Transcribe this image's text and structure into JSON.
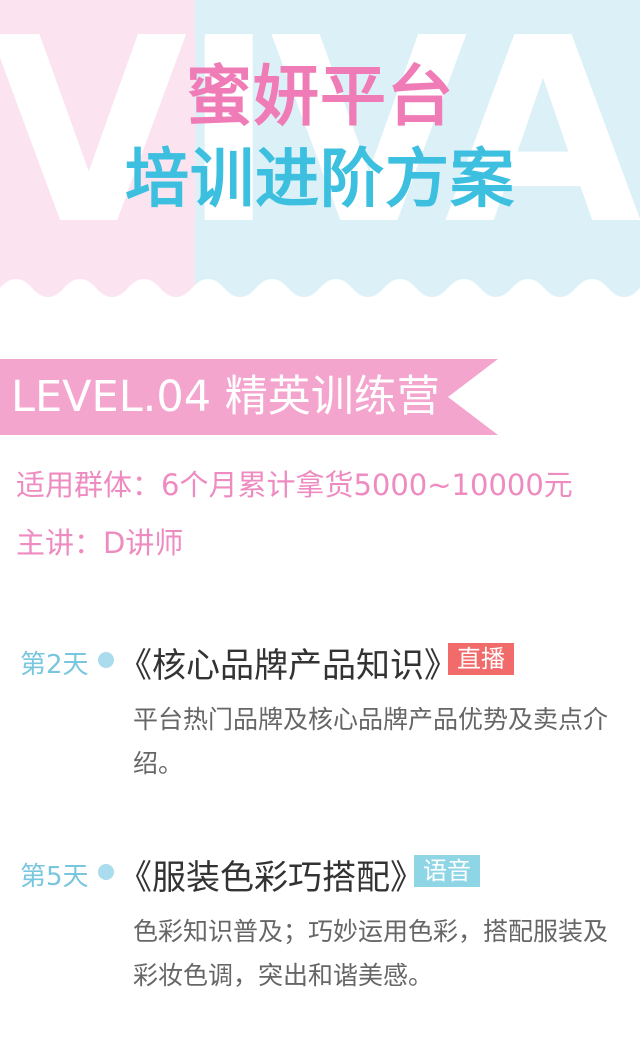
{
  "header": {
    "watermark": "VIVAN",
    "title": "蜜妍平台",
    "subtitle": "培训进阶方案"
  },
  "level": {
    "label": "LEVEL.04 精英训练营"
  },
  "info": {
    "audience": "适用群体：6个月累计拿货5000~10000元",
    "lecturer": "主讲：D讲师"
  },
  "courses": [
    {
      "day": "第2天",
      "title": "《核心品牌产品知识》",
      "badge": "直播",
      "description": "平台热门品牌及核心品牌产品优势及卖点介绍。"
    },
    {
      "day": "第5天",
      "title": "《服装色彩巧搭配》",
      "badge": "语音",
      "description": "色彩知识普及；巧妙运用色彩，搭配服装及彩妆色调，突出和谐美感。"
    }
  ],
  "colors": {
    "pink": "#f07cb7",
    "blue": "#3dbfe0",
    "badge_live": "#f26b6b",
    "badge_voice": "#8ed6e6"
  }
}
